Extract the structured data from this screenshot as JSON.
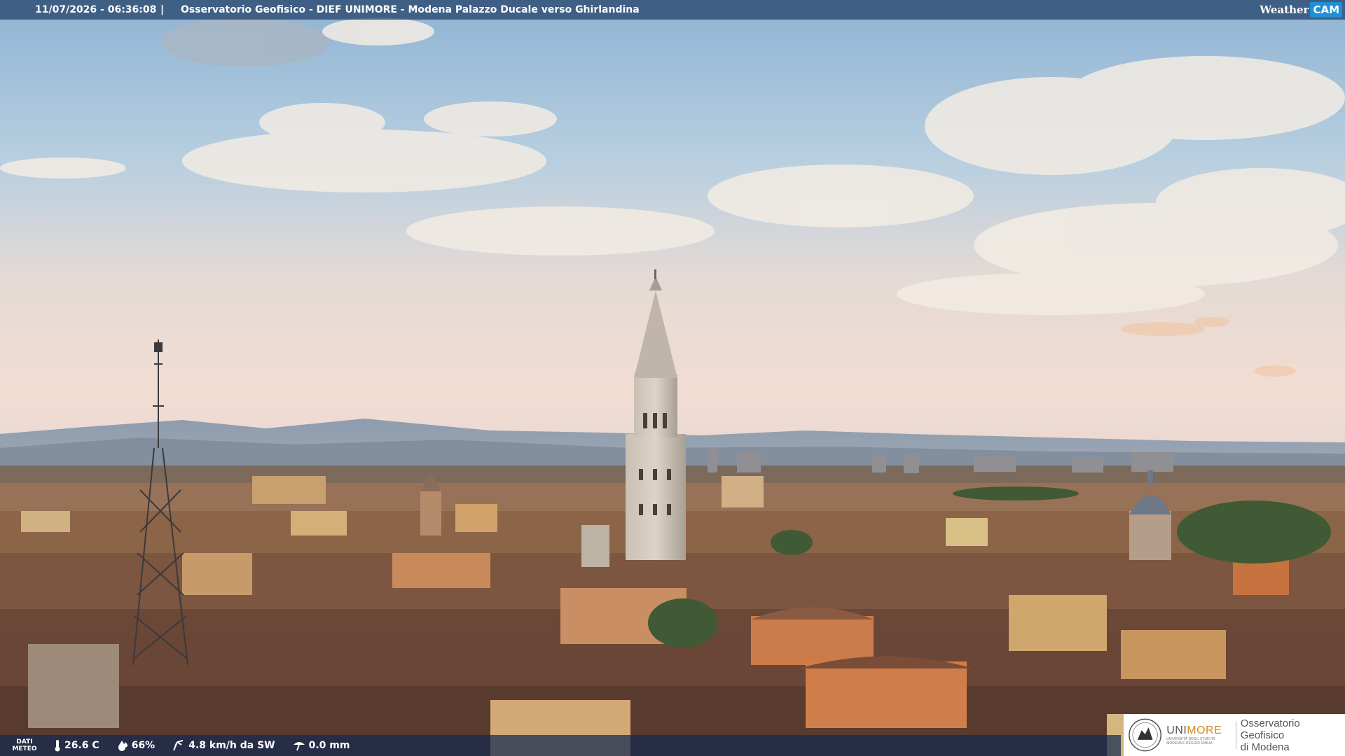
{
  "overlay": {
    "datetime": "11/07/2026 - 06:36:08",
    "separator": "|",
    "caption": "Osservatorio Geofisico - DIEF UNIMORE - Modena Palazzo Ducale verso Ghirlandina"
  },
  "brand": {
    "weather": "Weather",
    "cam": "CAM"
  },
  "meteo": {
    "label_line1": "DATI",
    "label_line2": "METEO",
    "temperature": "26.6 C",
    "humidity": "66%",
    "wind": "4.8 km/h da SW",
    "rain": "0.0 mm",
    "icons": [
      "thermometer-icon",
      "humidity-drop-icon",
      "wind-icon",
      "rain-gauge-icon"
    ]
  },
  "logo": {
    "uni": "UNI",
    "more": "MORE",
    "sub1": "UNIVERSITÀ DEGLI STUDI DI",
    "sub2": "MODENA E REGGIO EMILIA",
    "obs_line1": "Osservatorio Geofisico",
    "obs_line2": "di Modena"
  },
  "colors": {
    "overlay_bar": "#28466e",
    "cam_accent": "#1f8fd6",
    "unimore_accent": "#d28b1f"
  }
}
